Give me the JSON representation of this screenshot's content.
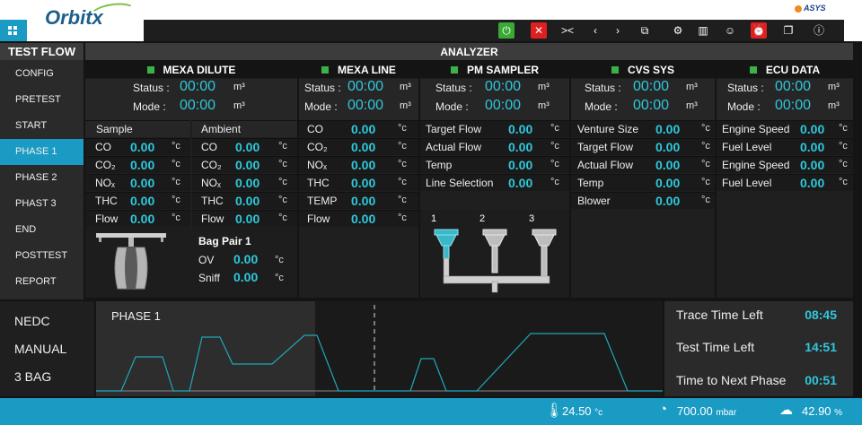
{
  "app": {
    "logo": "Orbitx",
    "brand": "ASYS"
  },
  "toolbar": {
    "icons": [
      "power-icon",
      "close-icon",
      "collapse-icon",
      "prev-icon",
      "next-icon",
      "windows-icon",
      "gear-icon",
      "columns-icon",
      "user-icon",
      "alarm-icon",
      "copy-icon",
      "info-icon"
    ]
  },
  "nav": {
    "title": "TEST FLOW",
    "items": [
      "CONFIG",
      "PRETEST",
      "START",
      "PHASE 1",
      "PHASE 2",
      "PHAST 3",
      "END",
      "POSTTEST",
      "REPORT"
    ],
    "active": "PHASE 1"
  },
  "analyzer": {
    "title": "ANALYZER",
    "status_label": "Status :",
    "mode_label": "Mode :",
    "time_value": "00:00",
    "unit_m3": "m³",
    "mexa_dilute": {
      "title": "MEXA DILUTE",
      "sample_header": "Sample",
      "ambient_header": "Ambient",
      "sample": [
        {
          "label": "CO",
          "value": "0.00",
          "unit": "°c"
        },
        {
          "label": "CO₂",
          "value": "0.00",
          "unit": "°c"
        },
        {
          "label": "NOₓ",
          "value": "0.00",
          "unit": "°c"
        },
        {
          "label": "THC",
          "value": "0.00",
          "unit": "°c"
        },
        {
          "label": "Flow",
          "value": "0.00",
          "unit": "°c"
        }
      ],
      "ambient": [
        {
          "label": "CO",
          "value": "0.00",
          "unit": "°c"
        },
        {
          "label": "CO₂",
          "value": "0.00",
          "unit": "°c"
        },
        {
          "label": "NOₓ",
          "value": "0.00",
          "unit": "°c"
        },
        {
          "label": "THC",
          "value": "0.00",
          "unit": "°c"
        },
        {
          "label": "Flow",
          "value": "0.00",
          "unit": "°c"
        }
      ],
      "bag_pair": {
        "title": "Bag Pair 1",
        "ov_label": "OV",
        "ov_value": "0.00",
        "sniff_label": "Sniff",
        "sniff_value": "0.00",
        "unit": "°c"
      }
    },
    "mexa_line": {
      "title": "MEXA LINE",
      "rows": [
        {
          "label": "CO",
          "value": "0.00",
          "unit": "°c"
        },
        {
          "label": "CO₂",
          "value": "0.00",
          "unit": "°c"
        },
        {
          "label": "NOₓ",
          "value": "0.00",
          "unit": "°c"
        },
        {
          "label": "THC",
          "value": "0.00",
          "unit": "°c"
        },
        {
          "label": "TEMP",
          "value": "0.00",
          "unit": "°c"
        },
        {
          "label": "Flow",
          "value": "0.00",
          "unit": "°c"
        }
      ]
    },
    "pm_sampler": {
      "title": "PM SAMPLER",
      "rows": [
        {
          "label": "Target Flow",
          "value": "0.00",
          "unit": "°c"
        },
        {
          "label": "Actual Flow",
          "value": "0.00",
          "unit": "°c"
        },
        {
          "label": "Temp",
          "value": "0.00",
          "unit": "°c"
        },
        {
          "label": "Line Selection",
          "value": "0.00",
          "unit": "°c"
        }
      ],
      "filters": [
        "1",
        "2",
        "3"
      ]
    },
    "cvs_sys": {
      "title": "CVS SYS",
      "rows": [
        {
          "label": "Venture Size",
          "value": "0.00",
          "unit": "°c"
        },
        {
          "label": "Target Flow",
          "value": "0.00",
          "unit": "°c"
        },
        {
          "label": "Actual Flow",
          "value": "0.00",
          "unit": "°c"
        },
        {
          "label": "Temp",
          "value": "0.00",
          "unit": "°c"
        },
        {
          "label": "Blower",
          "value": "0.00",
          "unit": "°c"
        }
      ]
    },
    "ecu_data": {
      "title": "ECU DATA",
      "rows": [
        {
          "label": "Engine Speed",
          "value": "0.00",
          "unit": "°c"
        },
        {
          "label": "Fuel Level",
          "value": "0.00",
          "unit": "°c"
        },
        {
          "label": "Engine Speed",
          "value": "0.00",
          "unit": "°c"
        },
        {
          "label": "Fuel Level",
          "value": "0.00",
          "unit": "°c"
        }
      ]
    }
  },
  "mode_list": [
    "NEDC",
    "MANUAL",
    "3 BAG"
  ],
  "graph": {
    "phase_label": "PHASE 1"
  },
  "times": [
    {
      "label": "Trace Time Left",
      "value": "08:45"
    },
    {
      "label": "Test Time Left",
      "value": "14:51"
    },
    {
      "label": "Time to Next Phase",
      "value": "00:51"
    }
  ],
  "status": {
    "temperature": "24.50",
    "temperature_unit": "°c",
    "pressure": "700.00",
    "pressure_unit": "mbar",
    "humidity": "42.90",
    "humidity_unit": "%"
  }
}
